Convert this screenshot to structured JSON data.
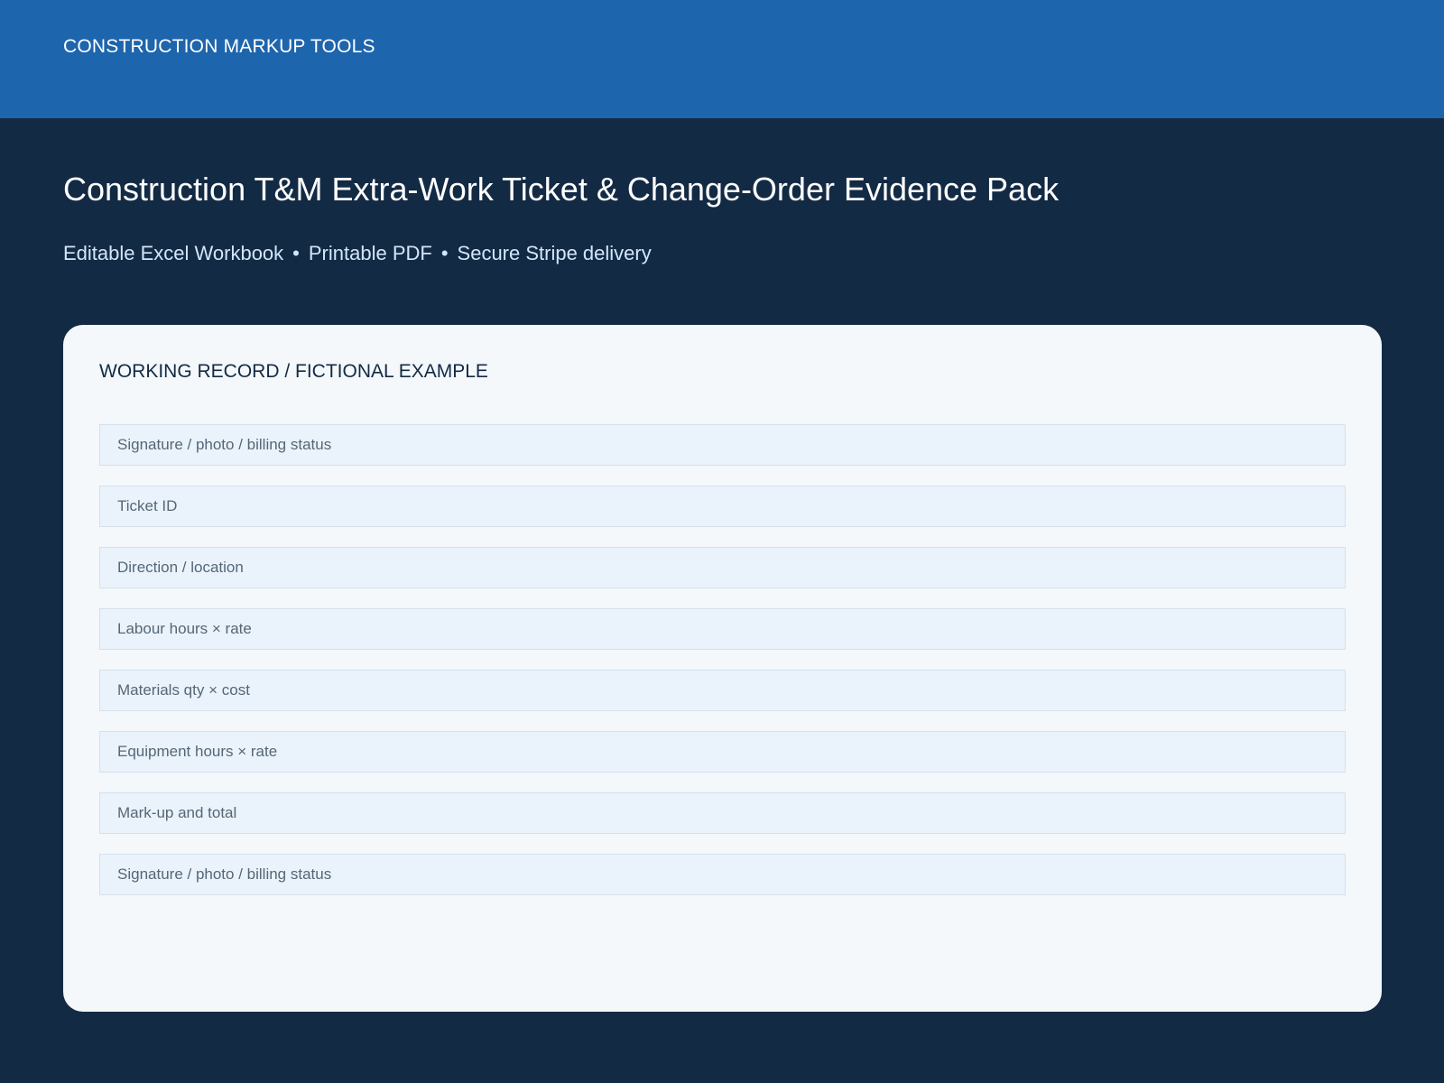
{
  "header": {
    "brand": "CONSTRUCTION MARKUP TOOLS"
  },
  "hero": {
    "title": "Construction T&M Extra-Work Ticket & Change-Order Evidence Pack",
    "features": [
      "Editable Excel Workbook",
      "Printable PDF",
      "Secure Stripe delivery"
    ],
    "separator": "•"
  },
  "card": {
    "heading": "WORKING RECORD / FICTIONAL EXAMPLE",
    "rows": [
      "Signature / photo / billing status",
      "Ticket ID",
      "Direction / location",
      "Labour hours × rate",
      "Materials qty × cost",
      "Equipment hours × rate",
      "Mark-up and total",
      "Signature / photo / billing status"
    ]
  },
  "colors": {
    "header_bg": "#1d65ad",
    "page_bg": "#132a44",
    "card_bg": "#f4f8fb",
    "row_bg": "#eaf3fb"
  }
}
